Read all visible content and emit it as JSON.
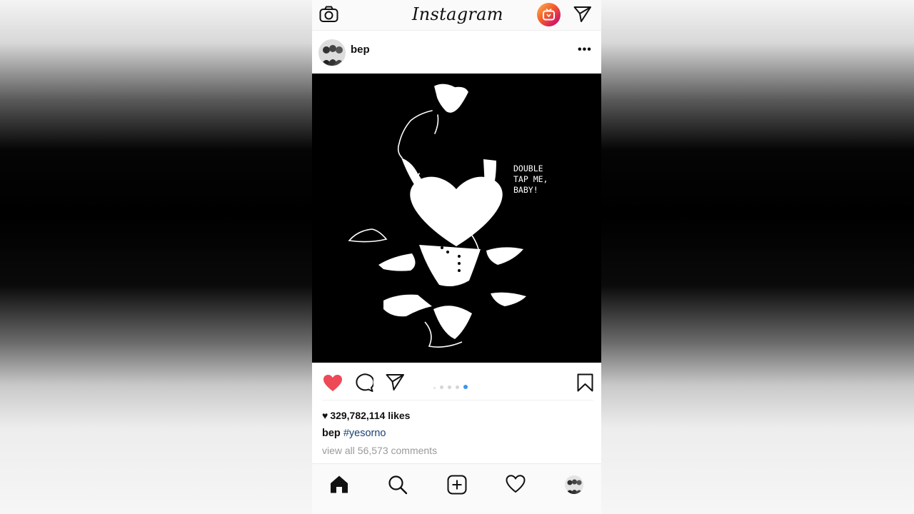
{
  "app": {
    "logo_text": "Instagram",
    "background": "#ffffff",
    "accent_like": "#ed4956",
    "link_color": "#1a3f73",
    "dot_active": "#3897f0"
  },
  "topbar": {
    "left_icon": "camera-icon",
    "right_icons": [
      "igtv-icon",
      "direct-message-icon"
    ]
  },
  "post": {
    "username": "bep",
    "menu_icon": "more-options-icon",
    "image": {
      "art_text": "DOUBLE\nTAP ME,\nBABY!"
    },
    "actions": {
      "liked": true,
      "icons": [
        "heart-icon",
        "comment-icon",
        "share-icon",
        "bookmark-icon"
      ]
    },
    "carousel": {
      "count": 5,
      "active_index": 4
    },
    "likes_count": "329,782,114 likes",
    "caption": {
      "username": "bep",
      "hashtag": "#yesorno"
    },
    "comments_link": "view all 56,573 comments"
  },
  "bottom_nav": {
    "items": [
      "home-icon",
      "search-icon",
      "add-post-icon",
      "activity-icon",
      "profile-avatar"
    ],
    "active": "home-icon"
  }
}
